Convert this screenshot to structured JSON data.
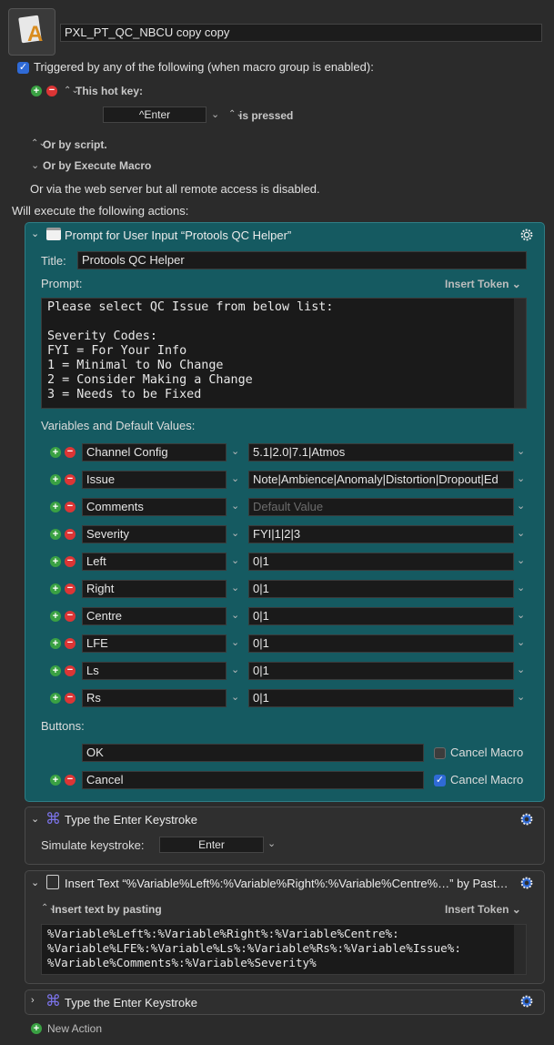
{
  "macro": {
    "name": "PXL_PT_QC_NBCU copy copy"
  },
  "trigger": {
    "header": "Triggered by any of the following (when macro group is enabled):",
    "hotkey_label": "This hot key:",
    "hotkey_value": "^Enter",
    "hotkey_state": "is pressed",
    "or_script": "Or by script.",
    "or_execute": "Or by Execute Macro",
    "web_server": "Or via the web server but all remote access is disabled.",
    "will_execute": "Will execute the following actions:"
  },
  "prompt_action": {
    "title": "Prompt for User Input “Protools QC Helper”",
    "title_label": "Title:",
    "title_value": "Protools QC Helper",
    "prompt_label": "Prompt:",
    "insert_token": "Insert Token",
    "prompt_lines": [
      "Please select QC Issue from below list:",
      "",
      "Severity Codes:",
      "FYI = For Your Info",
      "1 = Minimal to No Change",
      "2 = Consider Making a Change",
      "3 = Needs to be Fixed"
    ],
    "variables_label": "Variables and Default Values:",
    "variables": [
      {
        "name": "Channel Config",
        "default": "5.1|2.0|7.1|Atmos",
        "placeholder": ""
      },
      {
        "name": "Issue",
        "default": "Note|Ambience|Anomaly|Distortion|Dropout|Ed",
        "placeholder": ""
      },
      {
        "name": "Comments",
        "default": "",
        "placeholder": "Default Value"
      },
      {
        "name": "Severity",
        "default": "FYI|1|2|3",
        "placeholder": ""
      },
      {
        "name": "Left",
        "default": "0|1",
        "placeholder": ""
      },
      {
        "name": "Right",
        "default": "0|1",
        "placeholder": ""
      },
      {
        "name": "Centre",
        "default": "0|1",
        "placeholder": ""
      },
      {
        "name": "LFE",
        "default": "0|1",
        "placeholder": ""
      },
      {
        "name": "Ls",
        "default": "0|1",
        "placeholder": ""
      },
      {
        "name": "Rs",
        "default": "0|1",
        "placeholder": ""
      }
    ],
    "buttons_label": "Buttons:",
    "buttons": [
      {
        "name": "OK",
        "cancel_label": "Cancel Macro",
        "cancel_checked": false
      },
      {
        "name": "Cancel",
        "cancel_label": "Cancel Macro",
        "cancel_checked": true
      }
    ]
  },
  "type_action_1": {
    "title": "Type the Enter Keystroke",
    "sim_label": "Simulate keystroke:",
    "key": "Enter"
  },
  "insert_action": {
    "title": "Insert Text “%Variable%Left%:%Variable%Right%:%Variable%Centre%…” by Past…",
    "mode": "Insert text by pasting",
    "insert_token": "Insert Token",
    "text_lines": [
      "%Variable%Left%:%Variable%Right%:%Variable%Centre%:",
      "%Variable%LFE%:%Variable%Ls%:%Variable%Rs%:%Variable%Issue%:",
      "%Variable%Comments%:%Variable%Severity%"
    ]
  },
  "type_action_2": {
    "title": "Type the Enter Keystroke"
  },
  "new_action": "New Action",
  "colors": {
    "teal": "#155a61",
    "accent": "#2f6ad6",
    "plus": "#3aa143",
    "minus": "#dc3535"
  }
}
